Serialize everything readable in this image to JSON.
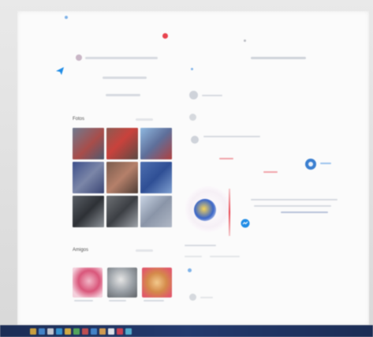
{
  "colors": {
    "accent_blue": "#1f8ce6",
    "accent_red": "#e8434e",
    "taskbar": "#1c2d55",
    "photo_tones": [
      "#6f7a8f",
      "#8c5a52",
      "#5e6f9a",
      "#3d4f8a",
      "#7a5b4d",
      "#4d6fb0",
      "#5a5f66",
      "#6d7074",
      "#8a95a8"
    ],
    "friend_tones": [
      "#d9567a",
      "#9aa0a6",
      "#d48a4a"
    ],
    "taskbar_icons": [
      "#e8b23a",
      "#4a90d9",
      "#e0e0e0",
      "#3aa3e0",
      "#f0c040",
      "#5cb85c",
      "#d9534f",
      "#4a90d9",
      "#f0ad4e",
      "#ffffff",
      "#e8434e",
      "#5bc0de"
    ]
  },
  "left_panel": {
    "photos_title": "Fotos",
    "friends_title": "Amigos",
    "photo_count": 9,
    "friend_count": 3
  },
  "icons": {
    "send": "send-icon",
    "notification": "notification-dot-icon",
    "messenger": "messenger-icon",
    "gear": "gear-icon"
  }
}
